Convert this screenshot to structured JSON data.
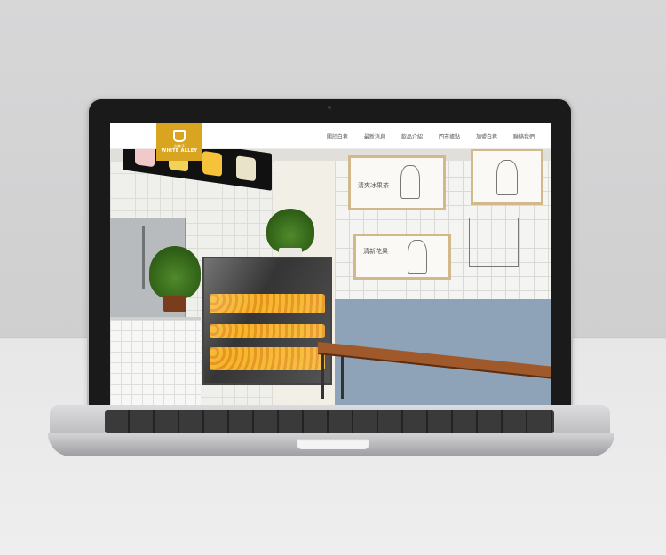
{
  "brand": {
    "name": "WHITE ALLEY",
    "chinese": "白巷子",
    "accent": "#d9a521"
  },
  "nav": {
    "items": [
      {
        "label": "關於白巷"
      },
      {
        "label": "最新消息"
      },
      {
        "label": "飲品介紹"
      },
      {
        "label": "門市據點"
      },
      {
        "label": "加盟白巷"
      },
      {
        "label": "聯絡我們"
      }
    ]
  },
  "hero": {
    "frame1_text": "清爽冰果茶",
    "frame2_text": "清新花果"
  }
}
